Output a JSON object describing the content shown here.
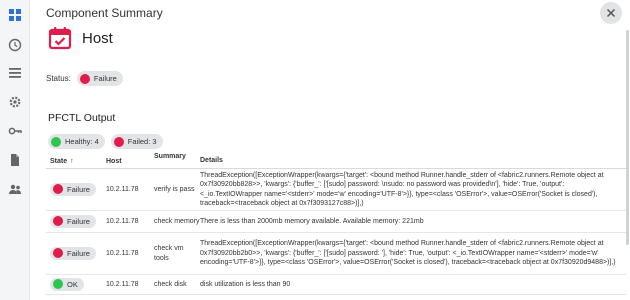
{
  "colors": {
    "failure": "#e01c4b",
    "ok": "#2ec44f",
    "host_icon": "#e01c4b"
  },
  "rail": {
    "items": [
      {
        "name": "dashboard-icon"
      },
      {
        "name": "clock-icon"
      },
      {
        "name": "list-icon"
      },
      {
        "name": "settings-icon"
      },
      {
        "name": "key-icon"
      },
      {
        "name": "document-icon"
      },
      {
        "name": "users-icon"
      }
    ]
  },
  "panel": {
    "title": "Component Summary",
    "host_name": "Host",
    "status_label": "Status:",
    "status_value": "Failure",
    "section_title": "PFCTL Output",
    "filters": {
      "healthy": "Healthy: 4",
      "failed": "Failed: 3"
    }
  },
  "table": {
    "headers": {
      "state": "State",
      "host": "Host",
      "summary": "Summary",
      "details": "Details"
    },
    "rows": [
      {
        "state": "Failure",
        "host": "10.2.11.78",
        "summary": "verify is pass",
        "details": "ThreadException([ExceptionWrapper(kwargs={'target': <bound method Runner.handle_stderr of <fabric2.runners.Remote object at 0x7f30920bb828>>, 'kwargs': {'buffer_': ['[sudo] password: \\nsudo: no password was provided\\n'], 'hide': True, 'output': <_io.TextIOWrapper name='<stderr>' mode='w' encoding='UTF-8'>}}, type=<class 'OSError'>, value=OSError('Socket is closed'), traceback=<traceback object at 0x7f3093127c88>)],)"
      },
      {
        "state": "Failure",
        "host": "10.2.11.78",
        "summary": "check memory",
        "details": "There is less than 2000mb memory available. Available memory: 221mb"
      },
      {
        "state": "Failure",
        "host": "10.2.11.78",
        "summary": "check vm tools",
        "details": "ThreadException([ExceptionWrapper(kwargs={'target': <bound method Runner.handle_stderr of <fabric2.runners.Remote object at 0x7f30920bb2b0>>, 'kwargs': {'buffer_': ['[sudo] password: '], 'hide': True, 'output': <_io.TextIOWrapper name='<stderr>' mode='w' encoding='UTF-8'>}}, type=<class 'OSError'>, value=OSError('Socket is closed'), traceback=<traceback object at 0x7f30920d9488>)],)"
      },
      {
        "state": "OK",
        "host": "10.2.11.78",
        "summary": "check disk",
        "details": "disk utilization is less than 90"
      }
    ]
  }
}
